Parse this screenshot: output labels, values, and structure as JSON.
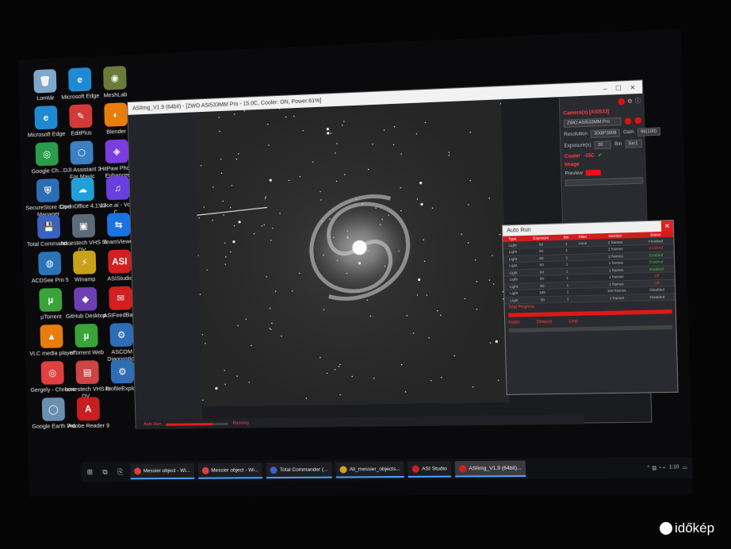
{
  "desktop": {
    "icons": [
      {
        "label": "Lomtár",
        "glyph": "🗑",
        "color": "#7fa7c9"
      },
      {
        "label": "Microsoft Edge",
        "glyph": "e",
        "color": "#1f8ad4"
      },
      {
        "label": "MeshLab",
        "glyph": "◉",
        "color": "#6c7a3a"
      },
      {
        "label": "Microsoft Edge",
        "glyph": "e",
        "color": "#1f8ad4"
      },
      {
        "label": "EditPlus",
        "glyph": "✎",
        "color": "#d23a3a"
      },
      {
        "label": "Blender",
        "glyph": "◐",
        "color": "#e87d0d"
      },
      {
        "label": "Google Ch...",
        "glyph": "◎",
        "color": "#2a9d4b"
      },
      {
        "label": "DJI Assistant 2 For Mavic",
        "glyph": "⬡",
        "color": "#3b7fc4"
      },
      {
        "label": "HitPaw Photo Enhancer",
        "glyph": "◈",
        "color": "#7a3de0"
      },
      {
        "label": "SecureStore Card Manager",
        "glyph": "⛨",
        "color": "#2d6db5"
      },
      {
        "label": "OpenOffice 4.1.12",
        "glyph": "☁",
        "color": "#1fa0d8"
      },
      {
        "label": "Voice.ai - Voice C...",
        "glyph": "♫",
        "color": "#6a3fe0"
      },
      {
        "label": "Total Command...",
        "glyph": "💾",
        "color": "#3a62c2"
      },
      {
        "label": "honestech VHS to DV...",
        "glyph": "▣",
        "color": "#5d6a7a"
      },
      {
        "label": "TeamViewer",
        "glyph": "⇆",
        "color": "#1c72e0"
      },
      {
        "label": "ACDSee Pro 5",
        "glyph": "◍",
        "color": "#2b73b8"
      },
      {
        "label": "Winamp",
        "glyph": "⚡",
        "color": "#c9a11a"
      },
      {
        "label": "ASIStudio",
        "glyph": "ASI",
        "color": "#d21f1f"
      },
      {
        "label": "µTorrent",
        "glyph": "µ",
        "color": "#3aa33a"
      },
      {
        "label": "GitHub Desktop",
        "glyph": "◆",
        "color": "#6e3fb0"
      },
      {
        "label": "ASIFeedBack",
        "glyph": "✉",
        "color": "#d21f1f"
      },
      {
        "label": "VLC media player",
        "glyph": "▲",
        "color": "#e87d0d"
      },
      {
        "label": "uTorrent Web",
        "glyph": "µ",
        "color": "#3aa33a"
      },
      {
        "label": "ASCOM Diagnostics",
        "glyph": "⚙",
        "color": "#2d6db5"
      },
      {
        "label": "Gergely - Chrome",
        "glyph": "◎",
        "color": "#e04040"
      },
      {
        "label": "honestech VHS to DV...",
        "glyph": "▤",
        "color": "#c44"
      },
      {
        "label": "ProfileExplo...",
        "glyph": "⚙",
        "color": "#2d6db5"
      },
      {
        "label": "Google Earth Pro",
        "glyph": "◯",
        "color": "#6b8fb0"
      },
      {
        "label": "Adobe Reader 9",
        "glyph": "A",
        "color": "#c81e1e"
      }
    ]
  },
  "asi_window": {
    "title": "ASIImg_V1.9 (64bit) - [ZWO ASI533MM Pro - 15.0C, Cooler: ON, Power:61%]",
    "right_panel": {
      "camera_header": "Camera(s) [ASI533]",
      "camera_name": "ZWO ASI533MM Pro",
      "resolution_label": "Resolution",
      "resolution_value": "3008*3008",
      "gain_label": "Gain",
      "gain_value": "96(100)",
      "exposure_label": "Exposure(s)",
      "exposure_value": "30",
      "bin_label": "Bin",
      "bin_value": "Bin1",
      "cooler_label": "Cooler",
      "cooler_value": "-15C",
      "image_label": "Image",
      "preview_label": "Preview"
    },
    "status_bar": {
      "progress_label": "Auto Run",
      "progress": 0.75,
      "state_text": "Running"
    }
  },
  "autorun": {
    "title": "Auto Run",
    "columns": [
      "Type",
      "Exposure",
      "Bin",
      "Filter",
      "Number",
      "Status"
    ],
    "rows": [
      {
        "type": "Light",
        "exp": "60",
        "bin": "1",
        "filter": "none",
        "num": "2 frames",
        "status": "Finished",
        "state": "off"
      },
      {
        "type": "Light",
        "exp": "60",
        "bin": "1",
        "filter": "",
        "num": "2 frames",
        "status": "Enabled",
        "state": "red"
      },
      {
        "type": "Light",
        "exp": "60",
        "bin": "1",
        "filter": "",
        "num": "2 frames",
        "status": "Enabled",
        "state": "on"
      },
      {
        "type": "Light",
        "exp": "60",
        "bin": "1",
        "filter": "",
        "num": "1 frames",
        "status": "Enabled",
        "state": "on"
      },
      {
        "type": "Light",
        "exp": "60",
        "bin": "1",
        "filter": "",
        "num": "1 frames",
        "status": "Enabled",
        "state": "on"
      },
      {
        "type": "Light",
        "exp": "60",
        "bin": "1",
        "filter": "",
        "num": "1 frames",
        "status": "Off",
        "state": "red"
      },
      {
        "type": "Light",
        "exp": "60",
        "bin": "1",
        "filter": "",
        "num": "1 frames",
        "status": "Off",
        "state": "red"
      },
      {
        "type": "Light",
        "exp": "180",
        "bin": "1",
        "filter": "",
        "num": "100 frames",
        "status": "Disabled",
        "state": "off"
      },
      {
        "type": "Light",
        "exp": "60",
        "bin": "1",
        "filter": "",
        "num": "1 frames",
        "status": "Disabled",
        "state": "off"
      }
    ],
    "total_progress_label": "Total Progress",
    "footer_left": "Folder",
    "footer_mid": "Delay(s)",
    "footer_right": "Loop"
  },
  "taskbar": {
    "items": [
      {
        "label": "Messier object - Wi...",
        "color": "#e04040",
        "active": false
      },
      {
        "label": "Messier object - Wi...",
        "color": "#e04040",
        "active": false
      },
      {
        "label": "Total Commander (...",
        "color": "#3a62c2",
        "active": false
      },
      {
        "label": "All_messier_objects...",
        "color": "#d8a020",
        "active": false
      },
      {
        "label": "ASI Studio",
        "color": "#d21f1f",
        "active": false
      },
      {
        "label": "ASIImg_V1.9 (64bit)...",
        "color": "#d21f1f",
        "active": true
      }
    ],
    "clock": "1:10"
  },
  "watermark": "időkép"
}
